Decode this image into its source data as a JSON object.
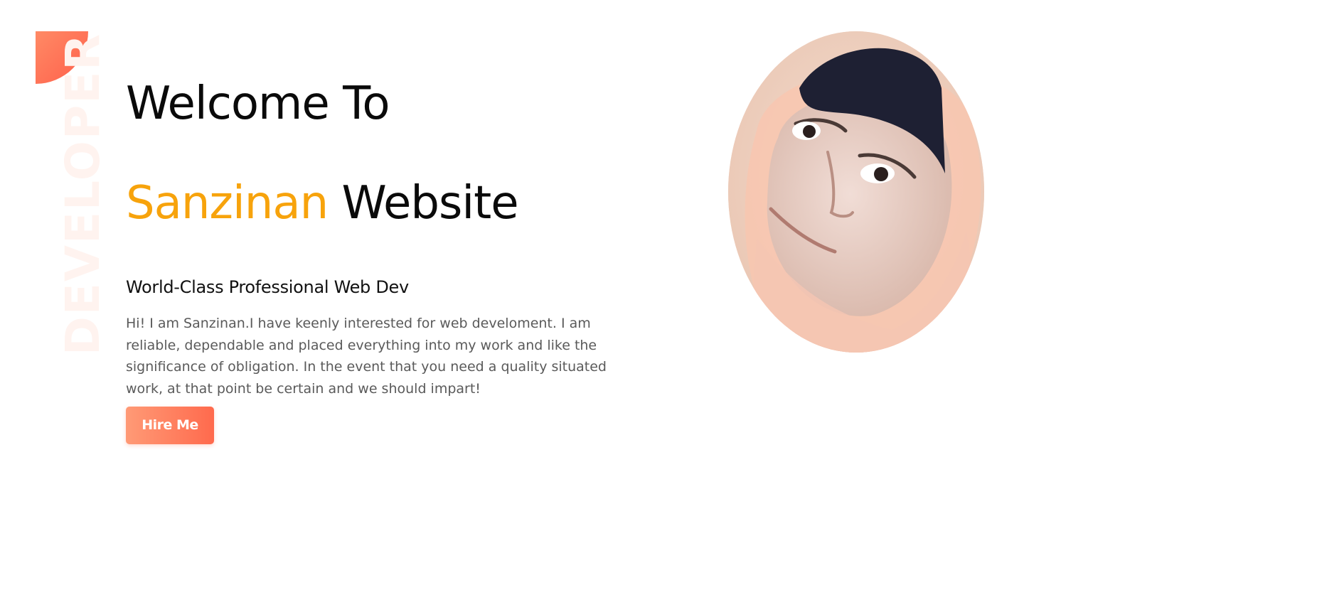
{
  "decor": {
    "vertical_word": "DEVELOPER",
    "accent_color": "#ff6a4d"
  },
  "hero": {
    "title_line1": "Welcome To",
    "title_line2_accent": "Sanzinan",
    "title_line2_rest": " Website",
    "accent_color": "#f7a30c",
    "subtitle": "World-Class Professional Web Dev",
    "description": "Hi! I am Sanzinan.I have keenly interested for web develoment. I am reliable, dependable and placed everything into my work and like the significance of obligation. In the event that you need a quality situated work, at that point be certain and we should impart!",
    "cta_label": "Hire Me"
  }
}
